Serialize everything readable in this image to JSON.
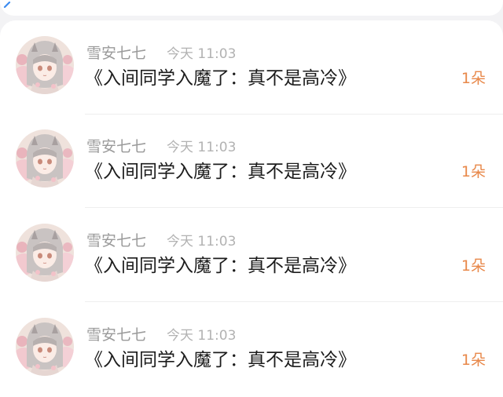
{
  "header": {
    "back_icon": "back-arrow-icon"
  },
  "colors": {
    "accent": "#e8884a",
    "name": "#9a9a9a",
    "time": "#b2b2b2",
    "message": "#1c1c1c"
  },
  "items": [
    {
      "name": "雪安七七",
      "time": "今天 11:03",
      "message": "《入间同学入魔了：真不是高冷》",
      "gift": "1朵",
      "avatar_icon": "anime-girl-avatar"
    },
    {
      "name": "雪安七七",
      "time": "今天 11:03",
      "message": "《入间同学入魔了：真不是高冷》",
      "gift": "1朵",
      "avatar_icon": "anime-girl-avatar"
    },
    {
      "name": "雪安七七",
      "time": "今天 11:03",
      "message": "《入间同学入魔了：真不是高冷》",
      "gift": "1朵",
      "avatar_icon": "anime-girl-avatar"
    },
    {
      "name": "雪安七七",
      "time": "今天 11:03",
      "message": "《入间同学入魔了：真不是高冷》",
      "gift": "1朵",
      "avatar_icon": "anime-girl-avatar"
    }
  ]
}
